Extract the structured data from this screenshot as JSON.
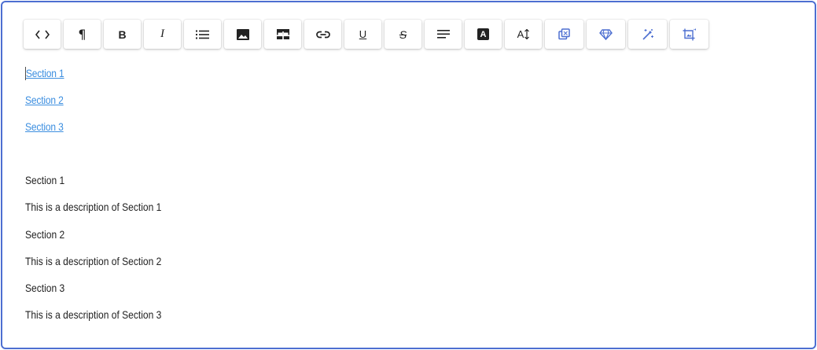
{
  "toolbar": {
    "buttons": [
      {
        "name": "code-view-button",
        "icon": "code-icon"
      },
      {
        "name": "paragraph-button",
        "icon": "pilcrow-icon"
      },
      {
        "name": "bold-button",
        "icon": "bold-icon"
      },
      {
        "name": "italic-button",
        "icon": "italic-icon"
      },
      {
        "name": "bullet-list-button",
        "icon": "list-icon"
      },
      {
        "name": "insert-image-button",
        "icon": "image-icon"
      },
      {
        "name": "insert-table-button",
        "icon": "table-icon"
      },
      {
        "name": "insert-link-button",
        "icon": "link-icon"
      },
      {
        "name": "underline-button",
        "icon": "underline-icon"
      },
      {
        "name": "strikethrough-button",
        "icon": "strikethrough-icon"
      },
      {
        "name": "align-button",
        "icon": "align-left-icon"
      },
      {
        "name": "text-color-button",
        "icon": "text-color-icon"
      },
      {
        "name": "font-size-button",
        "icon": "font-size-icon"
      },
      {
        "name": "duplicate-button",
        "icon": "copy-icon"
      },
      {
        "name": "premium-button",
        "icon": "diamond-icon"
      },
      {
        "name": "magic-button",
        "icon": "magic-wand-icon"
      },
      {
        "name": "crop-image-button",
        "icon": "crop-icon"
      }
    ],
    "accent_color": "#4d6fd1",
    "glyphs": {
      "paragraph": "¶",
      "bold": "B",
      "italic": "I",
      "underline": "U",
      "strike": "S",
      "text_color": "A",
      "font_size": "A"
    }
  },
  "toc": {
    "links": [
      "Section 1",
      "Section 2",
      "Section 3"
    ],
    "link_color": "#3d8fe0"
  },
  "body": {
    "paragraphs": [
      "Section 1",
      "This is a description of Section 1",
      "Section 2",
      "This is a description of Section 2",
      "Section 3",
      "This is a description of Section 3"
    ]
  },
  "editor": {
    "border_color": "#4d6fd1"
  }
}
